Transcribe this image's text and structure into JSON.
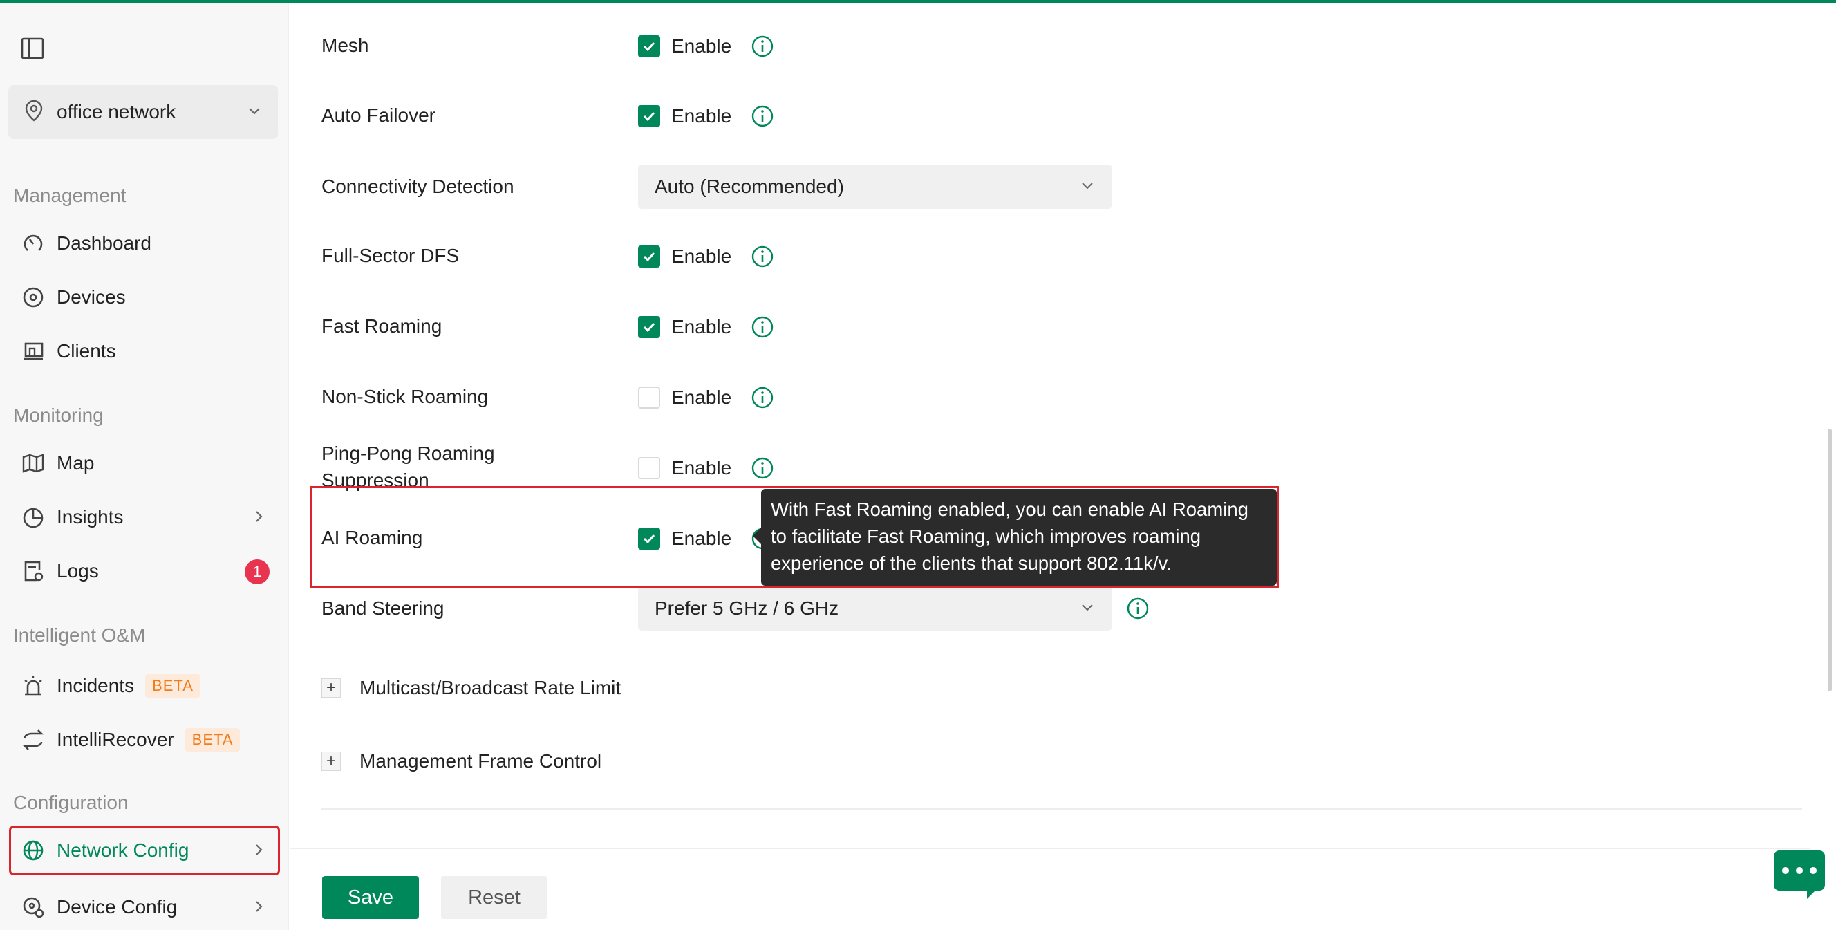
{
  "sidebar": {
    "site_name": "office network",
    "sections": {
      "management": "Management",
      "monitoring": "Monitoring",
      "intelligent": "Intelligent O&M",
      "configuration": "Configuration"
    },
    "items": {
      "dashboard": "Dashboard",
      "devices": "Devices",
      "clients": "Clients",
      "map": "Map",
      "insights": "Insights",
      "logs": "Logs",
      "logs_badge": "1",
      "incidents": "Incidents",
      "intellirecover": "IntelliRecover",
      "beta": "BETA",
      "network_config": "Network Config",
      "device_config": "Device Config"
    }
  },
  "settings": {
    "enable_label": "Enable",
    "mesh": {
      "label": "Mesh",
      "checked": true
    },
    "auto_failover": {
      "label": "Auto Failover",
      "checked": true
    },
    "connectivity_detection": {
      "label": "Connectivity Detection",
      "value": "Auto (Recommended)"
    },
    "full_sector_dfs": {
      "label": "Full-Sector DFS",
      "checked": true
    },
    "fast_roaming": {
      "label": "Fast Roaming",
      "checked": true
    },
    "non_stick_roaming": {
      "label": "Non-Stick Roaming",
      "checked": false
    },
    "ping_pong": {
      "label_line1": "Ping-Pong Roaming",
      "label_line2": "Suppression",
      "checked": false
    },
    "ai_roaming": {
      "label": "AI Roaming",
      "checked": true
    },
    "band_steering": {
      "label": "Band Steering",
      "value": "Prefer 5 GHz / 6 GHz"
    }
  },
  "tooltip": {
    "line1": "With Fast Roaming enabled, you can enable AI Roaming",
    "line2": "to facilitate Fast Roaming, which improves roaming",
    "line3": "experience of the clients that support 802.11k/v."
  },
  "collapsibles": {
    "multicast": "Multicast/Broadcast Rate Limit",
    "mgmt_frame": "Management Frame Control"
  },
  "footer": {
    "save": "Save",
    "reset": "Reset"
  },
  "colors": {
    "accent": "#00875a",
    "highlight": "#d9262c",
    "badge": "#e8344e",
    "beta_text": "#f07c1c"
  }
}
